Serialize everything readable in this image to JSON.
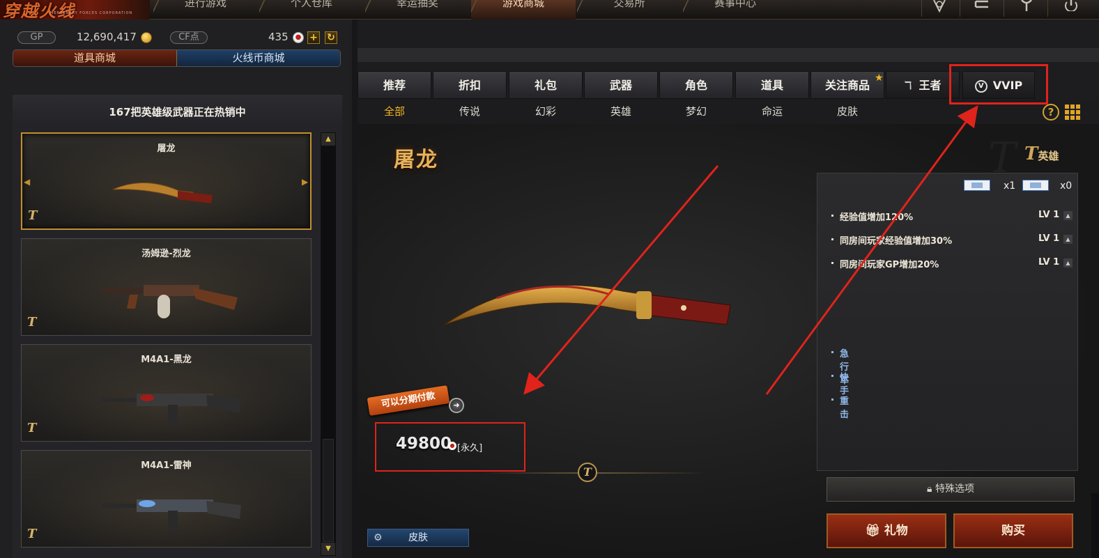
{
  "nav": {
    "logo_text": "穿越火线",
    "logo_sub": "MERCENARY FORCES CORPORATION",
    "tabs": [
      "进行游戏",
      "个人仓库",
      "幸运抽奖",
      "游戏商城",
      "交易所",
      "赛事中心"
    ],
    "active_tab": "游戏商城"
  },
  "wallet": {
    "gp_label": "GP",
    "gp_value": "12,690,417",
    "cf_label": "CF点",
    "cf_value": "435",
    "add_symbol": "+",
    "refresh_symbol": "↻"
  },
  "mall_tabs": [
    "道具商城",
    "火线币商城"
  ],
  "hot_header": "167把英雄级武器正在热销中",
  "items": [
    {
      "name": "屠龙",
      "selected": true
    },
    {
      "name": "汤姆逊-烈龙",
      "selected": false
    },
    {
      "name": "M4A1-黑龙",
      "selected": false
    },
    {
      "name": "M4A1-雷神",
      "selected": false
    }
  ],
  "categories": [
    "推荐",
    "折扣",
    "礼包",
    "武器",
    "角色",
    "道具",
    "关注商品",
    "王者",
    "VVIP"
  ],
  "subcategories": [
    "全部",
    "传说",
    "幻彩",
    "英雄",
    "梦幻",
    "命运",
    "皮肤"
  ],
  "active_subcategory": "全部",
  "detail": {
    "title": "屠龙",
    "rank_badge": "英雄",
    "ticket_counts": [
      "x1",
      "x0"
    ],
    "stats": [
      {
        "text": "经验值增加120%",
        "level": "LV 1"
      },
      {
        "text": "同房间玩家经验值增加30%",
        "level": "LV 1"
      },
      {
        "text": "同房间玩家GP增加20%",
        "level": "LV 1"
      }
    ],
    "tags": [
      "急行军",
      "快手",
      "重击"
    ],
    "installment_label": "可以分期付款",
    "price": "49800",
    "price_duration": "[永久]",
    "skin_button": "皮肤",
    "special_button": "特殊选项",
    "gift_button": "礼物",
    "buy_button": "购买"
  },
  "colors": {
    "accent_gold": "#f2b61e",
    "annotation_red": "#e0231b",
    "buy_red": "#9a2e14",
    "mall_blue": "#1f3f66"
  }
}
